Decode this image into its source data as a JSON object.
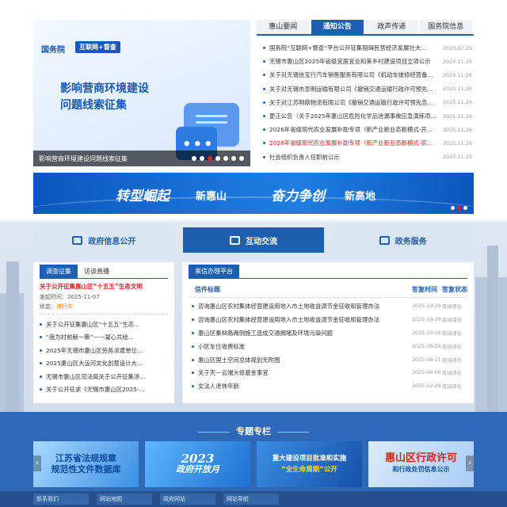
{
  "slider": {
    "brand": "国务院",
    "badge": "互联网+督查",
    "slogan_line1": "影响营商环境建设",
    "slogan_line2": "问题线索征集",
    "caption": "影响营商环境建设问题线索征集",
    "active_page": 3
  },
  "news_tabs": [
    "惠山要闻",
    "通知公告",
    "政声传递",
    "国务院信息"
  ],
  "news_active_tab": 1,
  "news": [
    {
      "title": "国务院“互联网+督查”平台公开征集阻碍民营经济发展壮大...",
      "date": "2023.07.29"
    },
    {
      "title": "无锡市惠山区2025年省级宜居宜业和美乡村建设项目立项公示",
      "date": "2025.11.26"
    },
    {
      "title": "关于对无锡信宝行汽车销售服务有限公司《机动车维修经营备...",
      "date": "2025.11.26"
    },
    {
      "title": "关于对无锡市圣明运输有限公司《撤销交通运输行政许可预先...",
      "date": "2025.11.26"
    },
    {
      "title": "关于对江苏明鼎物流有限公司《撤销交通运输行政许可预先告...",
      "date": "2025.11.26"
    },
    {
      "title": "更正公告（关于2025年惠山区危险化学品泄漏事故应急演练项...",
      "date": "2025.11.26"
    },
    {
      "title": "2026年省级现代农业发展补助专项（新产业新业态新模式-开...",
      "date": "2025.11.26"
    },
    {
      "title": "2026年省级现代农业发展补助专项（新产业新业态新模式-农...",
      "date": "2025.11.26",
      "highlight": true
    },
    {
      "title": "社会组织负责人任职前公示",
      "date": "2025.11.25"
    }
  ],
  "banner": {
    "b1": "转型崛起",
    "b2": "新惠山",
    "b3": "奋力争创",
    "b4": "新高地"
  },
  "section_tabs": [
    {
      "label": "政府信息公开",
      "icon": "monitor-icon"
    },
    {
      "label": "互动交流",
      "icon": "chat-icon"
    },
    {
      "label": "政务服务",
      "icon": "service-icon"
    }
  ],
  "section_active": 1,
  "left_panel": {
    "tabs": [
      "调查征集",
      "访谈直播"
    ],
    "feature_title": "关于公开征集惠山区“十五五”生态文明",
    "feature_date": "发起时间：2025-11-07",
    "feature_status_label": "状态：",
    "feature_status": "进行中",
    "items": [
      "关于公开征集惠山区“十五五”生态...",
      "“我为村前献一策”——凝心共绘...",
      "2025年无锡市惠山区劳务派遣单位...",
      "2025惠山区大运河文化创意设计大...",
      "无锡市惠山区司法局关于公开征集涉...",
      "关于公开征求《无锡市惠山区2025-..."
    ]
  },
  "right_panel": {
    "tab": "来信办理平台",
    "headers": [
      "信件标题",
      "答复时间",
      "答复状态"
    ],
    "items": [
      {
        "title": "咨询惠山区农村集体经营建设用地入市土地收益调节金征收和管理办法",
        "date": "2025-10-29",
        "status": "有待评价"
      },
      {
        "title": "咨询惠山区农村集体经营建设用地入市土地收益调节金征收和管理办法",
        "date": "2025-10-29",
        "status": "有待评价"
      },
      {
        "title": "惠山区秦林路两侧施工造成交通拥堵及环境污染问题",
        "date": "2025-10-16",
        "status": "有待评价"
      },
      {
        "title": "小区车位收费标准",
        "date": "2025-08-26",
        "status": "有待评价"
      },
      {
        "title": "惠山区国土空间总体规划无附图",
        "date": "2025-08-21",
        "status": "有待评价"
      },
      {
        "title": "关于天一云端大修基金事宜",
        "date": "2025-06-06",
        "status": "有待评价"
      },
      {
        "title": "女法人退休年龄",
        "date": "2025-02-28",
        "status": "有待评价"
      }
    ]
  },
  "special": {
    "title": "专题专栏",
    "cards": [
      {
        "line1": "江苏省法规规章",
        "line2": "规范性文件数据库"
      },
      {
        "line1": "2023",
        "line2": "政府开放月"
      },
      {
        "line1": "重大建设项目批准和实施",
        "line2": "“全生命周期”公开"
      },
      {
        "line1": "惠山区行政许可",
        "line2": "和行政处罚信息公示"
      }
    ]
  },
  "footer": [
    "联系我们",
    "网站地图",
    "政府网站",
    "网站导航"
  ]
}
